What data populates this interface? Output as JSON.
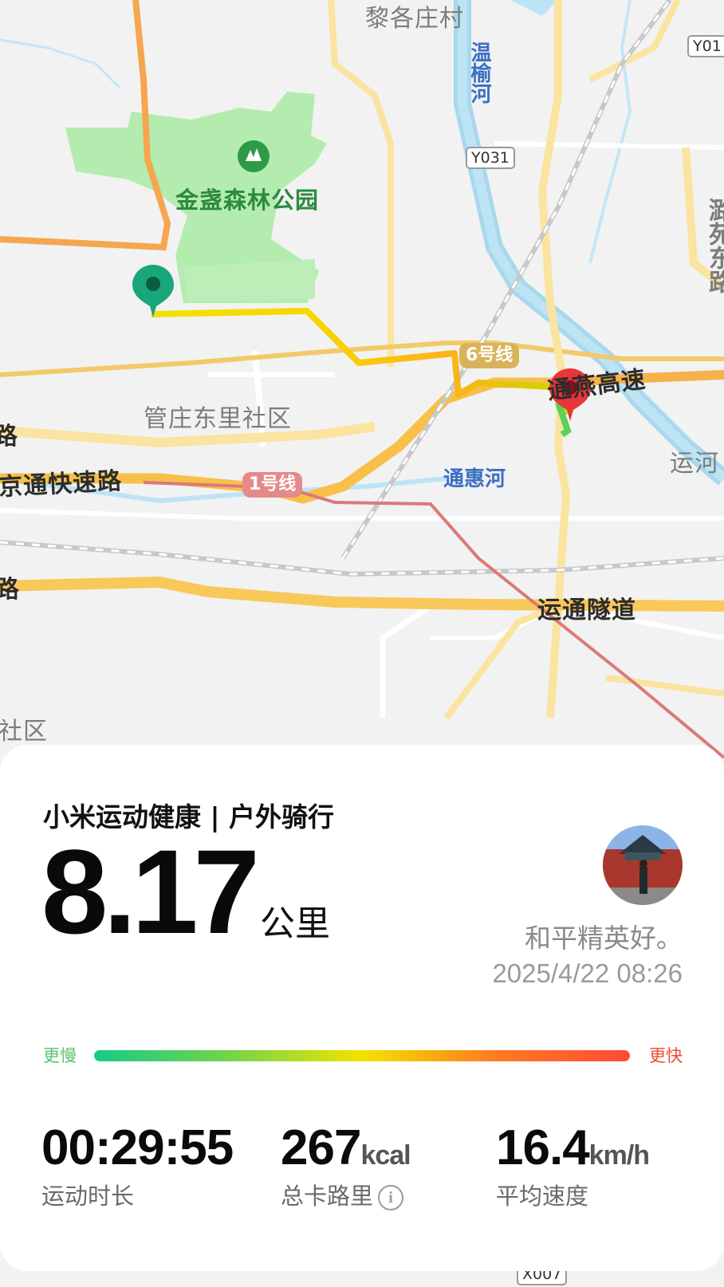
{
  "map": {
    "labels": {
      "village_top": "黎各庄村",
      "park": "金盏森林公园",
      "community": "管庄东里社区",
      "expressway_left": "京通快速路",
      "road_left_fragment_1": "路",
      "road_left_fragment_2": "路",
      "community_bottom": "社区",
      "river_vertical": "温榆河",
      "river_tonghui": "通惠河",
      "expressway_right": "通燕高速",
      "tunnel": "运通隧道",
      "canal": "运河",
      "road_right_vertical": "潞苑东路"
    },
    "shields": {
      "y031": "Y031",
      "y01": "Y01",
      "x007": "X007"
    },
    "metro": {
      "line6": "6号线",
      "line1": "1号线"
    },
    "start_marker_color": "#19a67a",
    "end_marker_color": "#e8353a"
  },
  "activity": {
    "app_title": "小米运动健康 | 户外骑行",
    "distance": "8.17",
    "distance_unit": "公里",
    "username": "和平精英好。",
    "datetime": "2025/4/22 08:26",
    "pace_scale": {
      "slow_label": "更慢",
      "fast_label": "更快"
    },
    "stats": {
      "duration": {
        "value": "00:29:55",
        "unit": "",
        "label": "运动时长"
      },
      "calories": {
        "value": "267",
        "unit": "kcal",
        "label": "总卡路里"
      },
      "avg_speed": {
        "value": "16.4",
        "unit": "km/h",
        "label": "平均速度"
      }
    }
  }
}
